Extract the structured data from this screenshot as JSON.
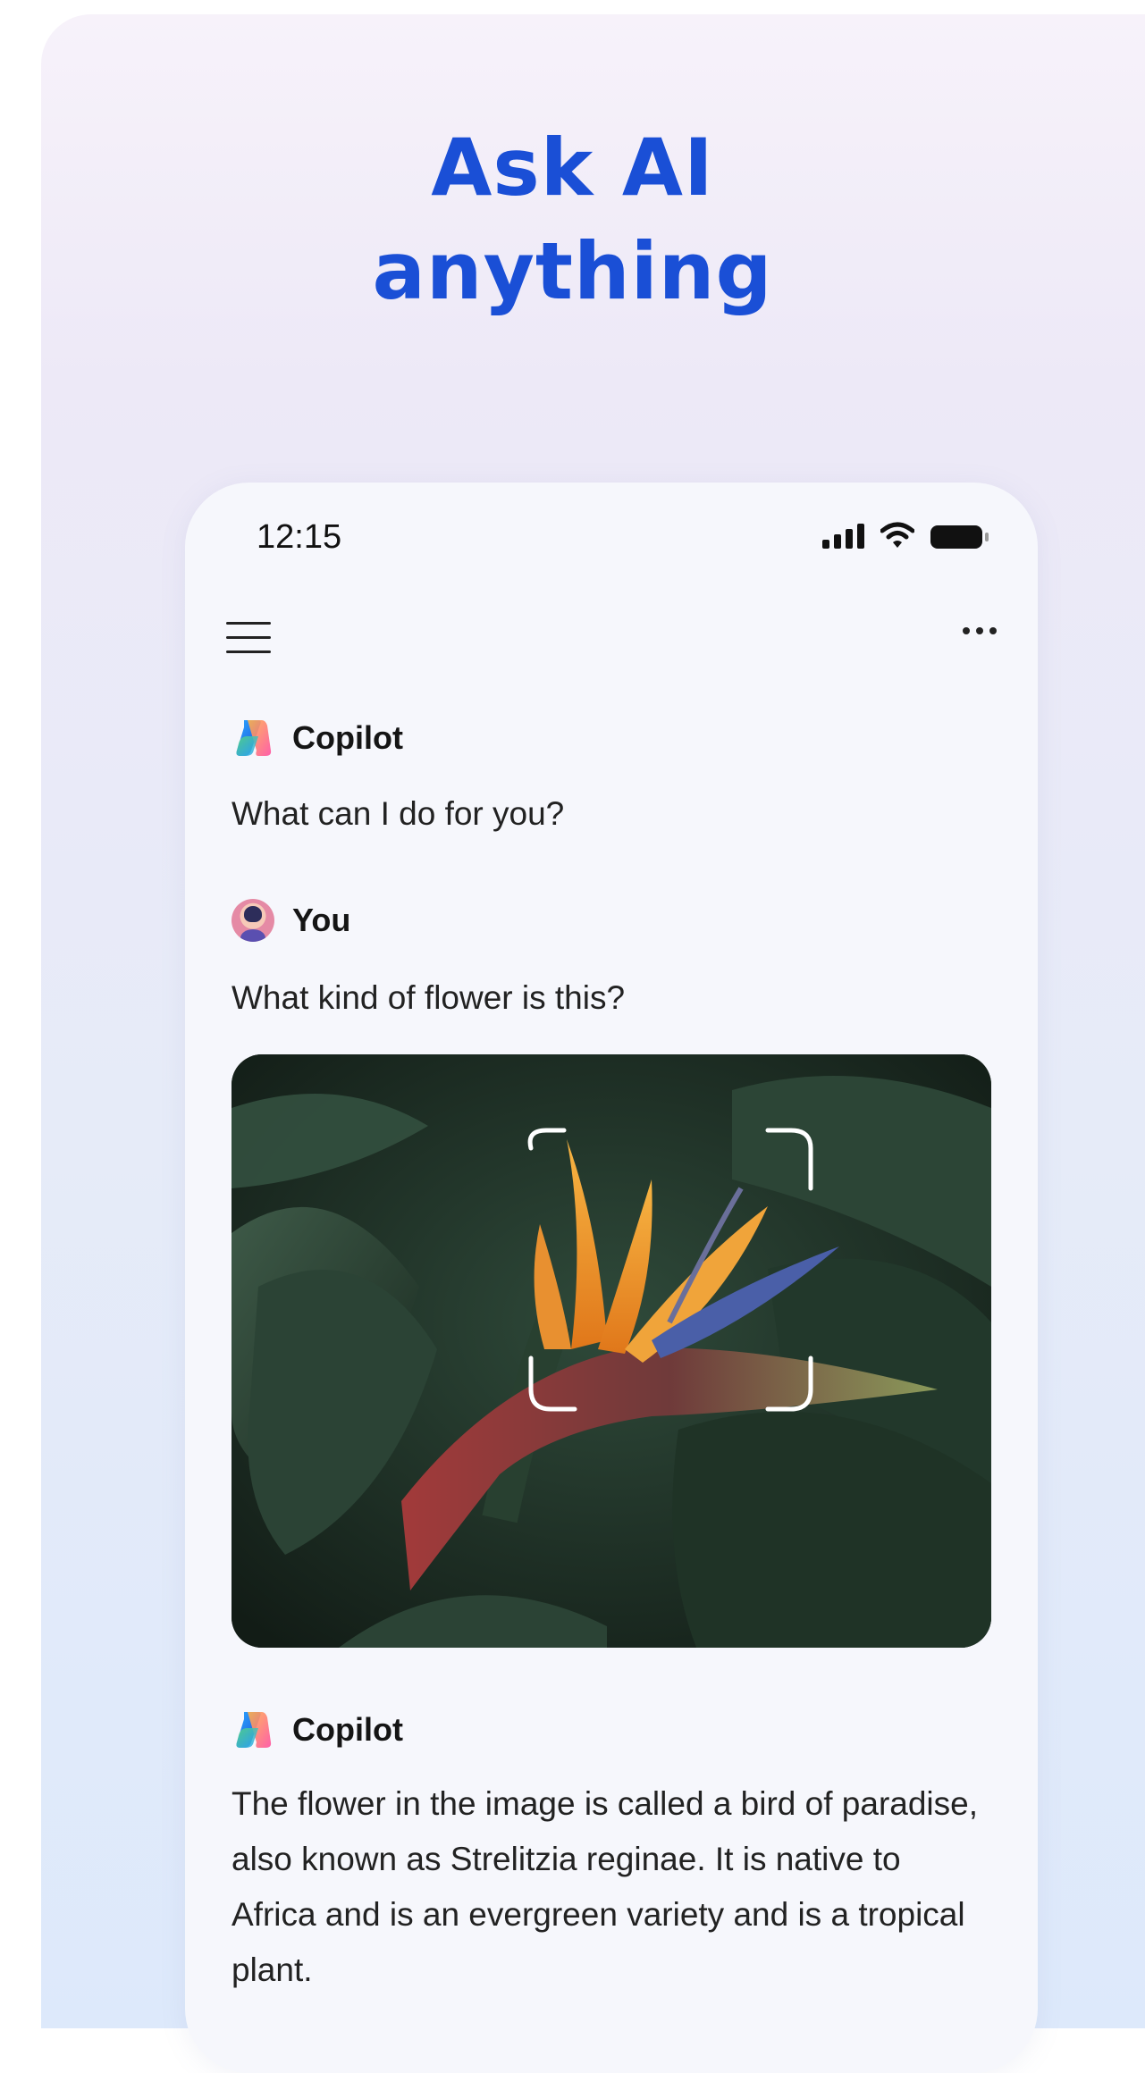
{
  "headline": {
    "line1": "Ask AI",
    "line2": "anything"
  },
  "status_bar": {
    "time": "12:15",
    "icons": [
      "signal-icon",
      "wifi-icon",
      "battery-icon"
    ]
  },
  "top_bar": {
    "left_icon": "hamburger-menu-icon",
    "right_icon": "more-options-icon"
  },
  "chat": [
    {
      "speaker": "Copilot",
      "text": "What can I do for you?"
    },
    {
      "speaker": "You",
      "text": "What kind of flower is this?"
    },
    {
      "speaker": "Copilot",
      "text": "The flower in the image is called a bird of paradise, also known as Strelitzia reginae. It is native to Africa and is an evergreen variety and is a tropical plant."
    }
  ],
  "colors": {
    "headline": "#1a4fd6",
    "background_top": "#f7f2fa",
    "background_bottom": "#dde9fb"
  }
}
